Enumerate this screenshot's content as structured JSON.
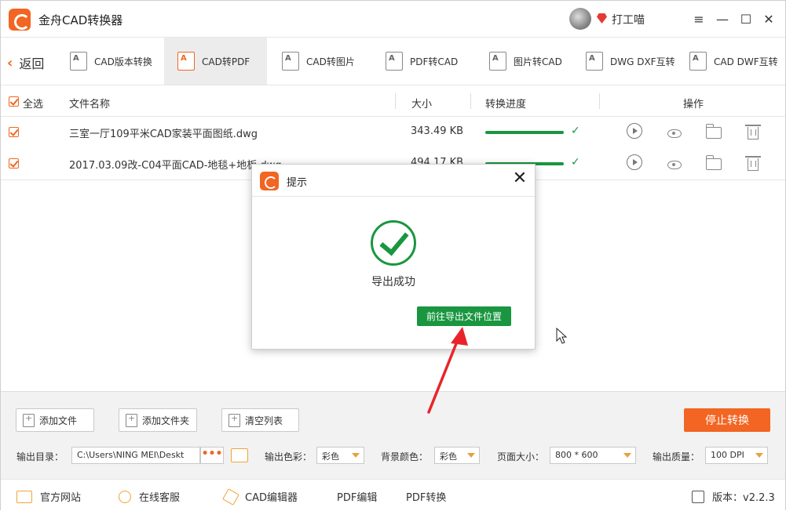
{
  "app": {
    "title": "金舟CAD转换器",
    "username": "打工喵",
    "brand_color": "#f26522",
    "success_color": "#1a9640"
  },
  "window_controls": {
    "menu": "≡",
    "minimize": "—",
    "maximize": "☐",
    "close": "✕"
  },
  "toolbar": {
    "back_label": "返回",
    "tabs": [
      {
        "label": "CAD版本转换"
      },
      {
        "label": "CAD转PDF",
        "active": true
      },
      {
        "label": "CAD转图片"
      },
      {
        "label": "PDF转CAD"
      },
      {
        "label": "图片转CAD"
      },
      {
        "label": "DWG DXF互转"
      },
      {
        "label": "CAD DWF互转"
      }
    ]
  },
  "table": {
    "select_all": "全选",
    "headers": {
      "name": "文件名称",
      "size": "大小",
      "progress": "转换进度",
      "actions": "操作"
    },
    "rows": [
      {
        "name": "三室一厅109平米CAD家装平面图纸.dwg",
        "size": "343.49 KB",
        "progress": 1.0,
        "checked": true
      },
      {
        "name": "2017.03.09改-C04平面CAD-地毯+地板.dwg",
        "size": "494.17 KB",
        "progress": 1.0,
        "checked": true
      }
    ]
  },
  "bottom": {
    "add_file": "添加文件",
    "add_folder": "添加文件夹",
    "clear_list": "清空列表",
    "stop": "停止转换",
    "output_dir_label": "输出目录：",
    "output_dir_value": "C:\\Users\\NING MEI\\Deskt",
    "browse": "•••",
    "color_label": "输出色彩：",
    "color_value": "彩色",
    "bg_label": "背景颜色：",
    "bg_value": "彩色",
    "page_label": "页面大小：",
    "page_value": "800 * 600",
    "quality_label": "输出质量：",
    "quality_value": "100 DPI"
  },
  "footer": {
    "website": "官方网站",
    "service": "在线客服",
    "cad_editor": "CAD编辑器",
    "pdf_edit": "PDF编辑",
    "pdf_convert": "PDF转换",
    "version": "版本：v2.2.3"
  },
  "dialog": {
    "title": "提示",
    "close": "✕",
    "message": "导出成功",
    "button": "前往导出文件位置"
  }
}
